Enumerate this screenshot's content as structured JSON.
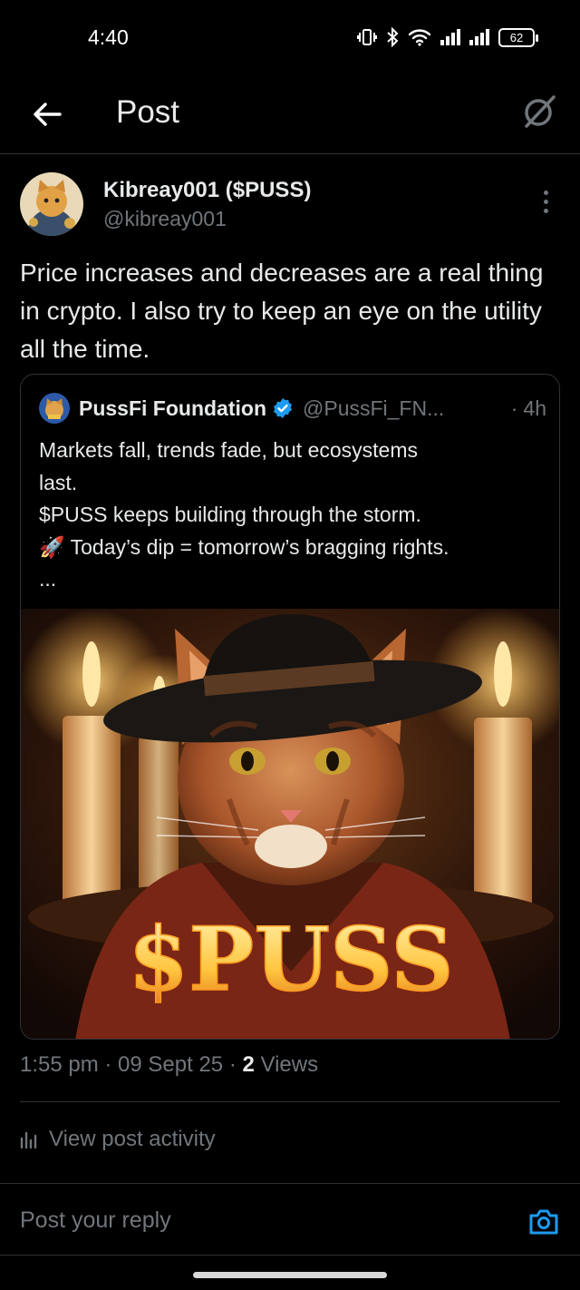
{
  "status_bar": {
    "time": "4:40",
    "battery": "62"
  },
  "header": {
    "title": "Post"
  },
  "post": {
    "author_name": "Kibreay001 ($PUSS)",
    "author_handle": "@kibreay001",
    "text": "Price increases and decreases are a real thing in crypto. I also try to keep an eye on the utility all the time.",
    "timestamp": "1:55 pm · 09 Sept 25 · ",
    "views_count": "2",
    "views_label": " Views"
  },
  "quote": {
    "name": "PussFi Foundation",
    "handle": "@PussFi_FN...",
    "separator": "·",
    "time": "4h",
    "lines": [
      "Markets fall, trends fade, but ecosystems",
      "last.",
      "$PUSS keeps building through the storm.",
      "🚀 Today’s dip = tomorrow’s bragging rights.",
      "..."
    ],
    "image_text": "$PUSS"
  },
  "activity": {
    "label": "View post activity"
  },
  "reply": {
    "placeholder": "Post your reply"
  },
  "colors": {
    "background": "#000000",
    "text": "#e7e9ea",
    "muted": "#71767b",
    "accent": "#1d9bf0",
    "border": "#2f3336"
  },
  "icons": [
    "back-arrow-icon",
    "grok-icon",
    "more-icon",
    "verified-icon",
    "analytics-icon",
    "camera-icon"
  ]
}
